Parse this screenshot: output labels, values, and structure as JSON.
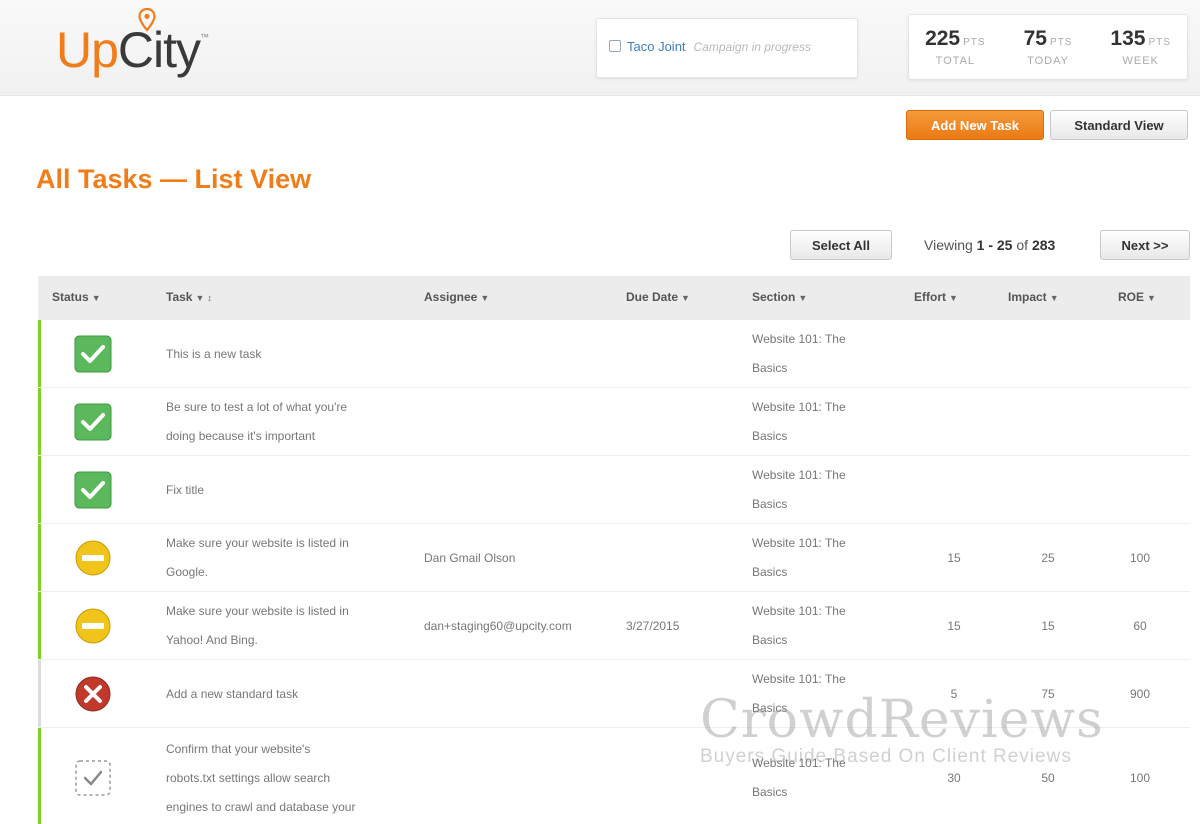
{
  "header": {
    "logo_up": "Up",
    "logo_city": "City",
    "campaign": {
      "name": "Taco Joint",
      "status": "Campaign in progress"
    },
    "points": [
      {
        "value": "225",
        "unit": "PTS",
        "label": "TOTAL"
      },
      {
        "value": "75",
        "unit": "PTS",
        "label": "TODAY"
      },
      {
        "value": "135",
        "unit": "PTS",
        "label": "WEEK"
      }
    ]
  },
  "actions": {
    "add_new_task": "Add New Task",
    "standard_view": "Standard View"
  },
  "page_title": "All Tasks — List View",
  "pagination": {
    "select_all": "Select All",
    "viewing_prefix": "Viewing",
    "range": "1 - 25",
    "of": "of",
    "total": "283",
    "next": "Next >>"
  },
  "columns": {
    "status": "Status",
    "task": "Task",
    "assignee": "Assignee",
    "due_date": "Due Date",
    "section": "Section",
    "effort": "Effort",
    "impact": "Impact",
    "roe": "ROE"
  },
  "rows": [
    {
      "status": "complete",
      "task": [
        "This is a new task"
      ],
      "assignee": "",
      "due": "",
      "section": [
        "Website 101: The",
        "Basics"
      ],
      "effort": "",
      "impact": "",
      "roe": ""
    },
    {
      "status": "complete",
      "task": [
        "Be sure to test a lot of what you're",
        "doing because it's important"
      ],
      "assignee": "",
      "due": "",
      "section": [
        "Website 101: The",
        "Basics"
      ],
      "effort": "",
      "impact": "",
      "roe": ""
    },
    {
      "status": "complete",
      "task": [
        "Fix title"
      ],
      "assignee": "",
      "due": "",
      "section": [
        "Website 101: The",
        "Basics"
      ],
      "effort": "",
      "impact": "",
      "roe": ""
    },
    {
      "status": "in-progress",
      "task": [
        "Make sure your website is listed in",
        "Google."
      ],
      "assignee": "Dan Gmail Olson",
      "due": "",
      "section": [
        "Website 101: The",
        "Basics"
      ],
      "effort": "15",
      "impact": "25",
      "roe": "100"
    },
    {
      "status": "in-progress",
      "task": [
        "Make sure your website is listed in",
        "Yahoo! And Bing."
      ],
      "assignee": "dan+staging60@upcity.com",
      "due": "3/27/2015",
      "section": [
        "Website 101: The",
        "Basics"
      ],
      "effort": "15",
      "impact": "15",
      "roe": "60"
    },
    {
      "status": "blocked",
      "task": [
        "Add a new standard task"
      ],
      "assignee": "",
      "due": "",
      "section": [
        "Website 101: The",
        "Basics"
      ],
      "effort": "5",
      "impact": "75",
      "roe": "900"
    },
    {
      "status": "todo",
      "task": [
        "Confirm that your website's",
        "robots.txt settings allow search",
        "engines to crawl and database your"
      ],
      "assignee": "",
      "due": "",
      "section": [
        "Website 101: The",
        "Basics"
      ],
      "effort": "30",
      "impact": "50",
      "roe": "100"
    }
  ],
  "watermark": {
    "title": "CrowdReviews",
    "tagline": "Buyers Guide Based On Client Reviews"
  },
  "colors": {
    "brand_orange": "#f07d1a",
    "complete_green": "#5cb85c",
    "in_progress_yellow": "#f0c419",
    "blocked_red": "#c0392b",
    "row_bar_green": "#7ed321"
  }
}
